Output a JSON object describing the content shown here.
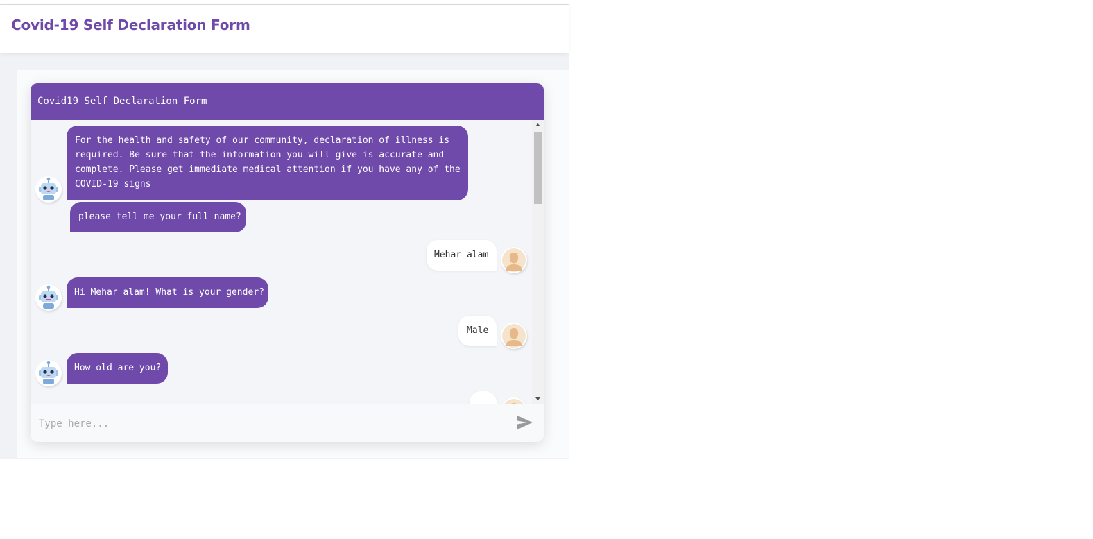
{
  "page": {
    "title": "Covid-19 Self Declaration Form"
  },
  "chat": {
    "header_title": "Covid19 Self Declaration Form",
    "messages": [
      {
        "sender": "bot",
        "lines": [
          "For the health and safety of our community, declaration of illness is",
          "required. Be sure that the information you will give is accurate and",
          "complete. Please get immediate medical attention if you have any of the",
          "COVID-19 signs"
        ]
      },
      {
        "sender": "bot",
        "text": "please tell me your full name?"
      },
      {
        "sender": "user",
        "text": "Mehar alam"
      },
      {
        "sender": "bot",
        "text": "Hi Mehar alam! What is your gender?"
      },
      {
        "sender": "user",
        "text": "Male"
      },
      {
        "sender": "bot",
        "text": "How old are you?"
      }
    ],
    "input": {
      "placeholder": "Type here...",
      "value": ""
    },
    "icons": {
      "bot_avatar": "robot-icon",
      "user_avatar": "user-avatar-icon",
      "send": "send-icon"
    },
    "colors": {
      "accent": "#6f4aab",
      "title": "#6f4aa8"
    }
  }
}
